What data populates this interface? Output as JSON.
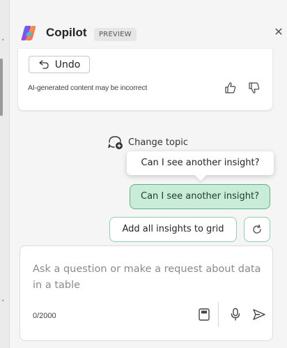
{
  "header": {
    "title": "Copilot",
    "badge": "PREVIEW",
    "close_glyph": "✕"
  },
  "response_card": {
    "undo_label": "Undo",
    "disclaimer": "AI-generated content may be incorrect"
  },
  "change_topic": {
    "label": "Change topic",
    "icon": "chat-add-icon"
  },
  "tooltip": {
    "text": "Can I see another insight?"
  },
  "conversation": {
    "user_message": "Can I see another insight?"
  },
  "suggestions": {
    "chip_label": "Add all insights to grid",
    "refresh_icon": "refresh-icon"
  },
  "composer": {
    "placeholder": "Ask a question or make a request about data in a table",
    "char_count": "0/2000"
  },
  "colors": {
    "accent_green": "#58b487",
    "user_bubble": "#c9ecd8",
    "chip_border": "#8fd0ad",
    "pane_background": "#f5f5f5"
  }
}
